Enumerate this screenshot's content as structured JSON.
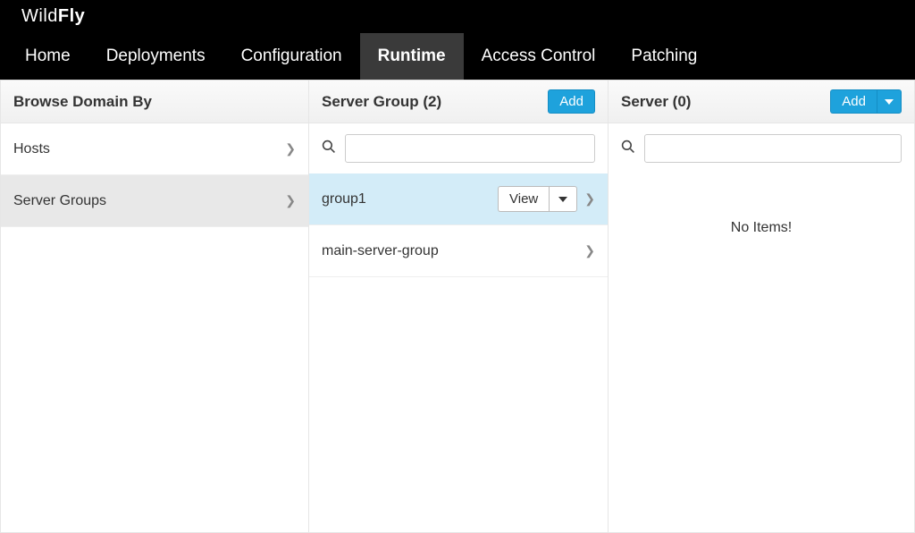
{
  "brand": {
    "part1": "Wild",
    "part2": "Fly"
  },
  "nav": {
    "home": "Home",
    "deployments": "Deployments",
    "configuration": "Configuration",
    "runtime": "Runtime",
    "access_control": "Access Control",
    "patching": "Patching",
    "active": "runtime"
  },
  "browse_panel": {
    "title": "Browse Domain By",
    "items": [
      {
        "label": "Hosts",
        "selected": false
      },
      {
        "label": "Server Groups",
        "selected": true
      }
    ]
  },
  "server_group_panel": {
    "title": "Server Group (2)",
    "add_label": "Add",
    "search_value": "",
    "items": [
      {
        "label": "group1",
        "selected": true,
        "view_label": "View"
      },
      {
        "label": "main-server-group",
        "selected": false
      }
    ]
  },
  "server_panel": {
    "title": "Server (0)",
    "add_label": "Add",
    "search_value": "",
    "empty_message": "No Items!"
  }
}
